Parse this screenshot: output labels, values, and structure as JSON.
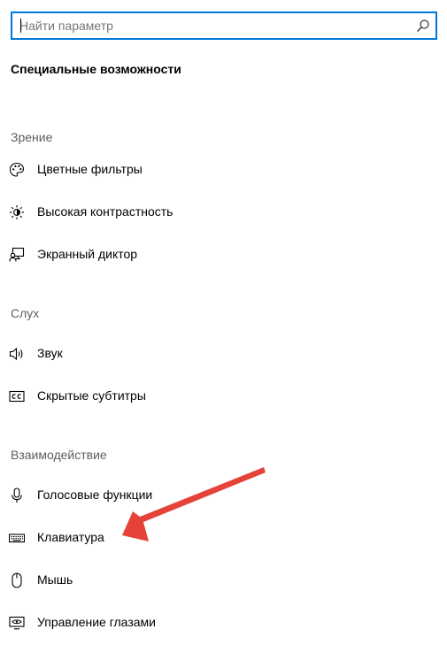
{
  "search": {
    "placeholder": "Найти параметр",
    "icon": "search-icon"
  },
  "page": {
    "title": "Специальные возможности"
  },
  "groups": [
    {
      "header": "Зрение",
      "items": [
        {
          "label": "Цветные фильтры",
          "icon": "palette-icon"
        },
        {
          "label": "Высокая контрастность",
          "icon": "brightness-icon"
        },
        {
          "label": "Экранный диктор",
          "icon": "narrator-icon"
        }
      ]
    },
    {
      "header": "Слух",
      "items": [
        {
          "label": "Звук",
          "icon": "speaker-icon"
        },
        {
          "label": "Скрытые субтитры",
          "icon": "closed-captions-icon"
        }
      ]
    },
    {
      "header": "Взаимодействие",
      "items": [
        {
          "label": "Голосовые функции",
          "icon": "microphone-icon"
        },
        {
          "label": "Клавиатура",
          "icon": "keyboard-icon"
        },
        {
          "label": "Мышь",
          "icon": "mouse-icon"
        },
        {
          "label": "Управление глазами",
          "icon": "eye-control-icon"
        }
      ]
    }
  ],
  "colors": {
    "accent": "#0078d7",
    "annotation_arrow": "#e5433a",
    "group_header_text": "#5d5d5d"
  }
}
